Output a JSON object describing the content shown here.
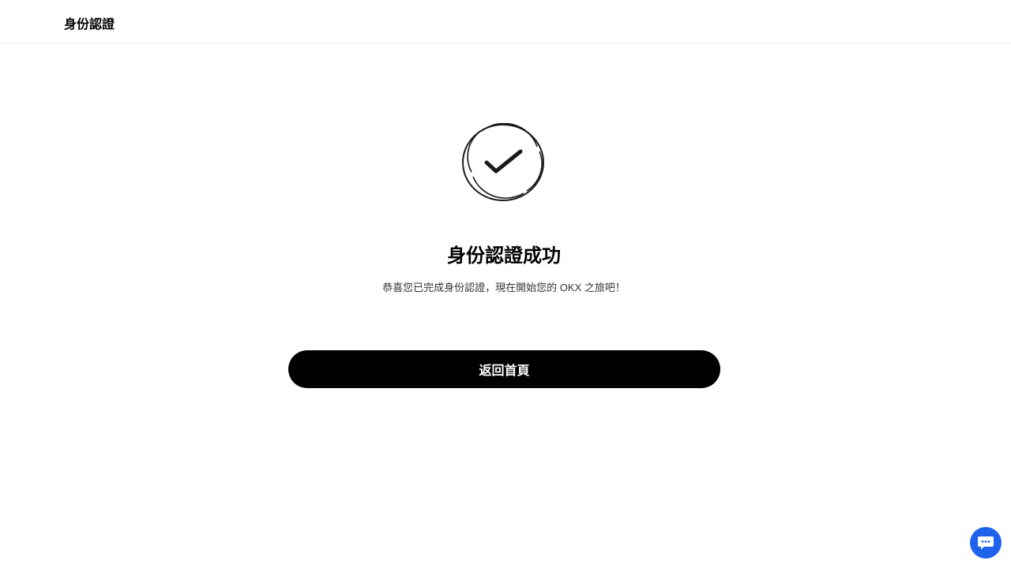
{
  "header": {
    "title": "身份認證"
  },
  "main": {
    "icon": "check-circle-icon",
    "title": "身份認證成功",
    "description": "恭喜您已完成身份認證，現在開始您的 OKX 之旅吧！",
    "button_label": "返回首頁"
  },
  "chat": {
    "icon": "chat-bubble-icon",
    "color": "#1e62ec"
  }
}
